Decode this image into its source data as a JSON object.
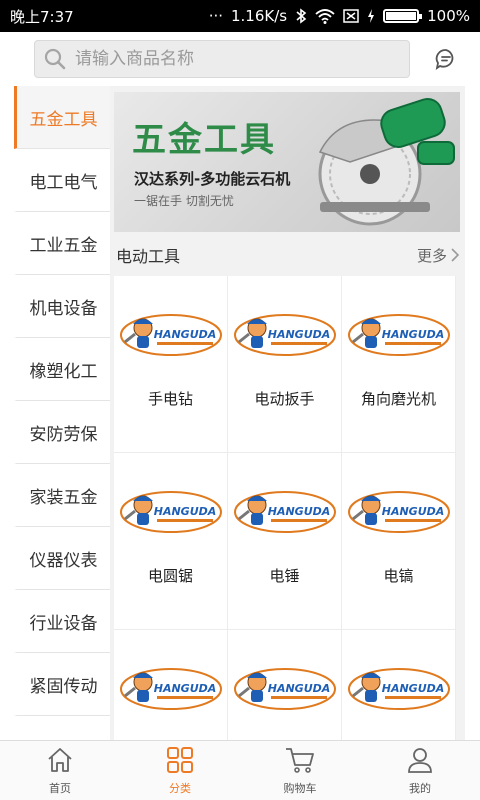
{
  "status_bar": {
    "time": "晚上7:37",
    "speed": "1.16K/s",
    "battery": "100%",
    "battery_level": 1.0
  },
  "search": {
    "placeholder": "请输入商品名称"
  },
  "sidebar": {
    "items": [
      {
        "label": "五金工具",
        "active": true
      },
      {
        "label": "电工电气",
        "active": false
      },
      {
        "label": "工业五金",
        "active": false
      },
      {
        "label": "机电设备",
        "active": false
      },
      {
        "label": "橡塑化工",
        "active": false
      },
      {
        "label": "安防劳保",
        "active": false
      },
      {
        "label": "家装五金",
        "active": false
      },
      {
        "label": "仪器仪表",
        "active": false
      },
      {
        "label": "行业设备",
        "active": false
      },
      {
        "label": "紧固传动",
        "active": false
      }
    ]
  },
  "banner": {
    "title": "五金工具",
    "subtitle": "汉达系列-多功能云石机",
    "slogan": "一锯在手 切割无忧"
  },
  "section": {
    "title": "电动工具",
    "more": "更多"
  },
  "logo_text": "HANGUDA",
  "products": [
    {
      "name": "手电钻"
    },
    {
      "name": "电动扳手"
    },
    {
      "name": "角向磨光机"
    },
    {
      "name": "电圆锯"
    },
    {
      "name": "电锤"
    },
    {
      "name": "电镐"
    },
    {
      "name": ""
    },
    {
      "name": ""
    },
    {
      "name": ""
    }
  ],
  "bottom_nav": {
    "items": [
      {
        "label": "首页",
        "icon": "home-icon",
        "active": false
      },
      {
        "label": "分类",
        "icon": "category-icon",
        "active": true
      },
      {
        "label": "购物车",
        "icon": "cart-icon",
        "active": false
      },
      {
        "label": "我的",
        "icon": "user-icon",
        "active": false
      }
    ]
  },
  "colors": {
    "accent": "#ee7a26",
    "banner_green": "#2e8c48"
  }
}
